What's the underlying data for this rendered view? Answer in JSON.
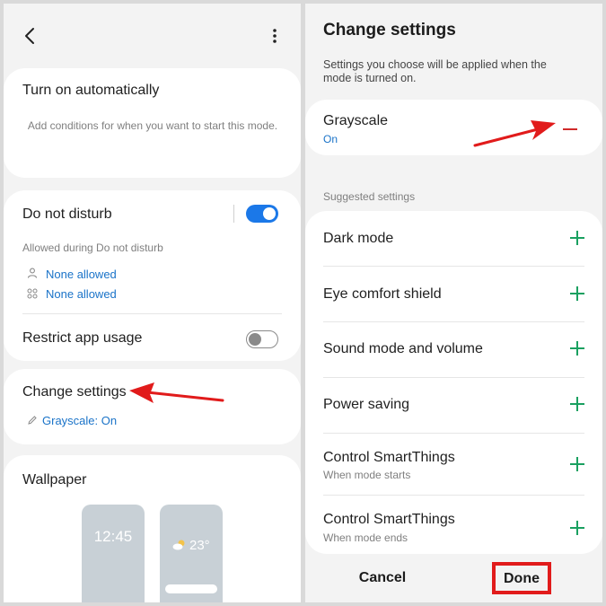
{
  "left": {
    "turn_on": {
      "title": "Turn on automatically",
      "description": "Add conditions for when you want to start this mode."
    },
    "dnd": {
      "title": "Do not disturb",
      "allowed_label": "Allowed during Do not disturb",
      "people": "None allowed",
      "apps": "None allowed",
      "toggle": "on"
    },
    "restrict": {
      "title": "Restrict app usage",
      "toggle": "off"
    },
    "change_settings": {
      "title": "Change settings",
      "value": "Grayscale: On"
    },
    "wallpaper": {
      "title": "Wallpaper",
      "clock": "12:45",
      "weather": "23°"
    }
  },
  "right": {
    "title": "Change settings",
    "description": "Settings you choose will be applied when the mode is turned on.",
    "selected": {
      "name": "Grayscale",
      "status": "On"
    },
    "suggested_label": "Suggested settings",
    "suggested": [
      {
        "name": "Dark mode",
        "sub": ""
      },
      {
        "name": "Eye comfort shield",
        "sub": ""
      },
      {
        "name": "Sound mode and volume",
        "sub": ""
      },
      {
        "name": "Power saving",
        "sub": ""
      },
      {
        "name": "Control SmartThings",
        "sub": "When mode starts"
      },
      {
        "name": "Control SmartThings",
        "sub": "When mode ends"
      }
    ],
    "cancel_label": "Cancel",
    "done_label": "Done"
  },
  "colors": {
    "accent_blue": "#1a73c8",
    "toggle_on": "#1b78e8",
    "add_green": "#1aa060",
    "remove_red": "#d02a2a",
    "annotation_red": "#e11b1b"
  }
}
